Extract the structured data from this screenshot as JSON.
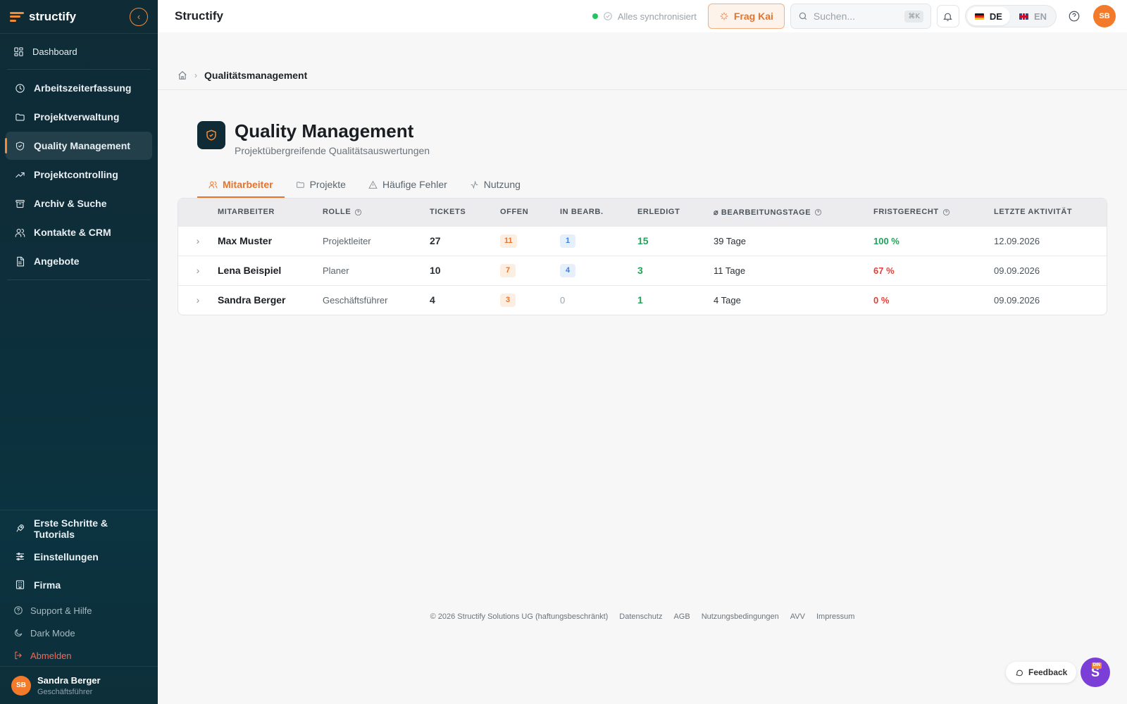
{
  "sidebar": {
    "logo": "structify",
    "nav": [
      {
        "label": "Dashboard",
        "icon": "dashboard-icon"
      },
      {
        "label": "Arbeitszeiterfassung",
        "icon": "clock-icon"
      },
      {
        "label": "Projektverwaltung",
        "icon": "folder-icon"
      },
      {
        "label": "Quality Management",
        "icon": "shield-icon",
        "active": true
      },
      {
        "label": "Projektcontrolling",
        "icon": "trend-icon"
      },
      {
        "label": "Archiv & Suche",
        "icon": "archive-icon"
      },
      {
        "label": "Kontakte & CRM",
        "icon": "users-icon"
      },
      {
        "label": "Angebote",
        "icon": "document-icon"
      }
    ],
    "bottom_nav": [
      {
        "label": "Erste Schritte & Tutorials",
        "icon": "rocket-icon"
      },
      {
        "label": "Einstellungen",
        "icon": "sliders-icon"
      },
      {
        "label": "Firma",
        "icon": "building-icon"
      }
    ],
    "support": "Support & Hilfe",
    "dark_mode": "Dark Mode",
    "logout": "Abmelden",
    "user": {
      "initials": "SB",
      "name": "Sandra Berger",
      "role": "Geschäftsführer"
    }
  },
  "topbar": {
    "title": "Structify",
    "sync_status": "Alles synchronisiert",
    "ask_button": "Frag Kai",
    "search_placeholder": "Suchen...",
    "search_shortcut": "⌘K",
    "lang_de": "DE",
    "lang_en": "EN",
    "avatar_initials": "SB"
  },
  "breadcrumb": {
    "current": "Qualitätsmanagement"
  },
  "page": {
    "title": "Quality Management",
    "subtitle": "Projektübergreifende Qualitätsauswertungen"
  },
  "tabs": [
    {
      "label": "Mitarbeiter",
      "active": true
    },
    {
      "label": "Projekte"
    },
    {
      "label": "Häufige Fehler"
    },
    {
      "label": "Nutzung"
    }
  ],
  "table": {
    "headers": {
      "employee": "Mitarbeiter",
      "role": "Rolle",
      "tickets": "Tickets",
      "open": "Offen",
      "in_progress": "In Bearb.",
      "done": "Erledigt",
      "avg_days": "⌀ Bearbeitungstage",
      "on_time": "Fristgerecht",
      "last_activity": "Letzte Aktivität"
    },
    "rows": [
      {
        "name": "Max Muster",
        "role": "Projektleiter",
        "tickets": "27",
        "open": "11",
        "in_progress": "1",
        "done": "15",
        "avg_days": "39 Tage",
        "on_time": "100 %",
        "last_activity": "12.09.2026"
      },
      {
        "name": "Lena Beispiel",
        "role": "Planer",
        "tickets": "10",
        "open": "7",
        "in_progress": "4",
        "done": "3",
        "avg_days": "11 Tage",
        "on_time": "67 %",
        "last_activity": "09.09.2026"
      },
      {
        "name": "Sandra Berger",
        "role": "Geschäftsführer",
        "tickets": "4",
        "open": "3",
        "in_progress": "0",
        "done": "1",
        "avg_days": "4 Tage",
        "on_time": "0 %",
        "last_activity": "09.09.2026"
      }
    ]
  },
  "footer": {
    "copyright": "© 2026 Structify Solutions UG (haftungsbeschränkt)",
    "links": [
      "Datenschutz",
      "AGB",
      "Nutzungsbedingungen",
      "AVV",
      "Impressum"
    ]
  },
  "floating": {
    "feedback": "Feedback",
    "fab_letter": "S",
    "fab_badge": "DIN"
  },
  "colors": {
    "accent": "#e8732a",
    "sidebar": "#0f2b36",
    "success": "#22a35a",
    "danger": "#e0413a",
    "info": "#3d7fd9",
    "fab": "#7b3fd8"
  }
}
